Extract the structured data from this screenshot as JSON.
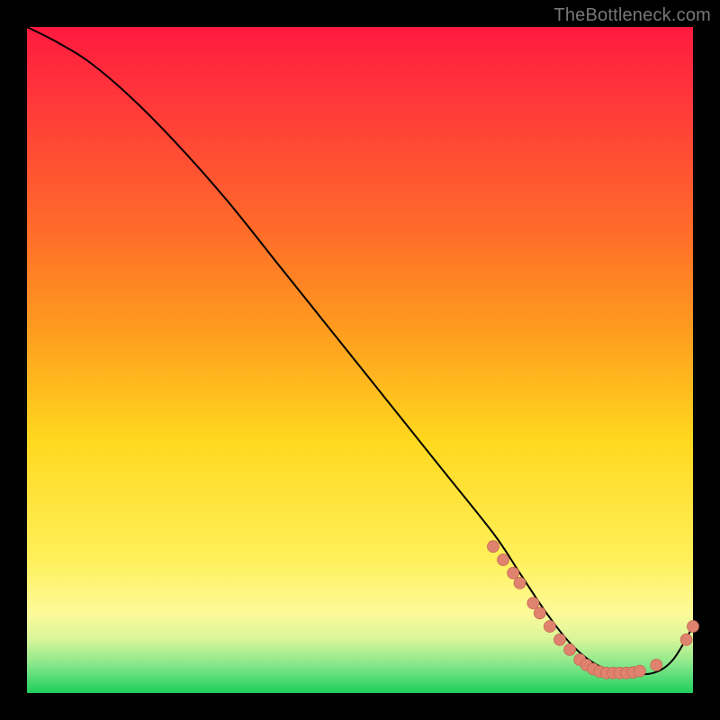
{
  "watermark": "TheBottleneck.com",
  "colors": {
    "curve_stroke": "#000000",
    "marker_fill": "#e0836e",
    "marker_stroke": "#c46a56"
  },
  "chart_data": {
    "type": "line",
    "title": "",
    "xlabel": "",
    "ylabel": "",
    "xlim": [
      0,
      100
    ],
    "ylim": [
      0,
      100
    ],
    "grid": false,
    "legend": false,
    "series": [
      {
        "name": "curve",
        "x": [
          0,
          4,
          9,
          15,
          22,
          30,
          38,
          46,
          54,
          62,
          70,
          74,
          78,
          82,
          86,
          90,
          94,
          97,
          100
        ],
        "y": [
          100,
          98,
          95,
          90,
          83,
          74,
          64,
          54,
          44,
          34,
          24,
          18,
          12,
          7,
          4,
          3,
          3,
          5,
          10
        ]
      }
    ],
    "markers": [
      {
        "x": 70.0,
        "y": 22.0
      },
      {
        "x": 71.5,
        "y": 20.0
      },
      {
        "x": 73.0,
        "y": 18.0
      },
      {
        "x": 74.0,
        "y": 16.5
      },
      {
        "x": 76.0,
        "y": 13.5
      },
      {
        "x": 77.0,
        "y": 12.0
      },
      {
        "x": 78.5,
        "y": 10.0
      },
      {
        "x": 80.0,
        "y": 8.0
      },
      {
        "x": 81.5,
        "y": 6.5
      },
      {
        "x": 83.0,
        "y": 5.0
      },
      {
        "x": 84.0,
        "y": 4.2
      },
      {
        "x": 85.0,
        "y": 3.6
      },
      {
        "x": 86.0,
        "y": 3.2
      },
      {
        "x": 87.0,
        "y": 3.0
      },
      {
        "x": 88.0,
        "y": 3.0
      },
      {
        "x": 89.0,
        "y": 3.0
      },
      {
        "x": 90.0,
        "y": 3.0
      },
      {
        "x": 91.0,
        "y": 3.1
      },
      {
        "x": 92.0,
        "y": 3.3
      },
      {
        "x": 94.5,
        "y": 4.2
      },
      {
        "x": 99.0,
        "y": 8.0
      },
      {
        "x": 100.0,
        "y": 10.0
      }
    ]
  }
}
